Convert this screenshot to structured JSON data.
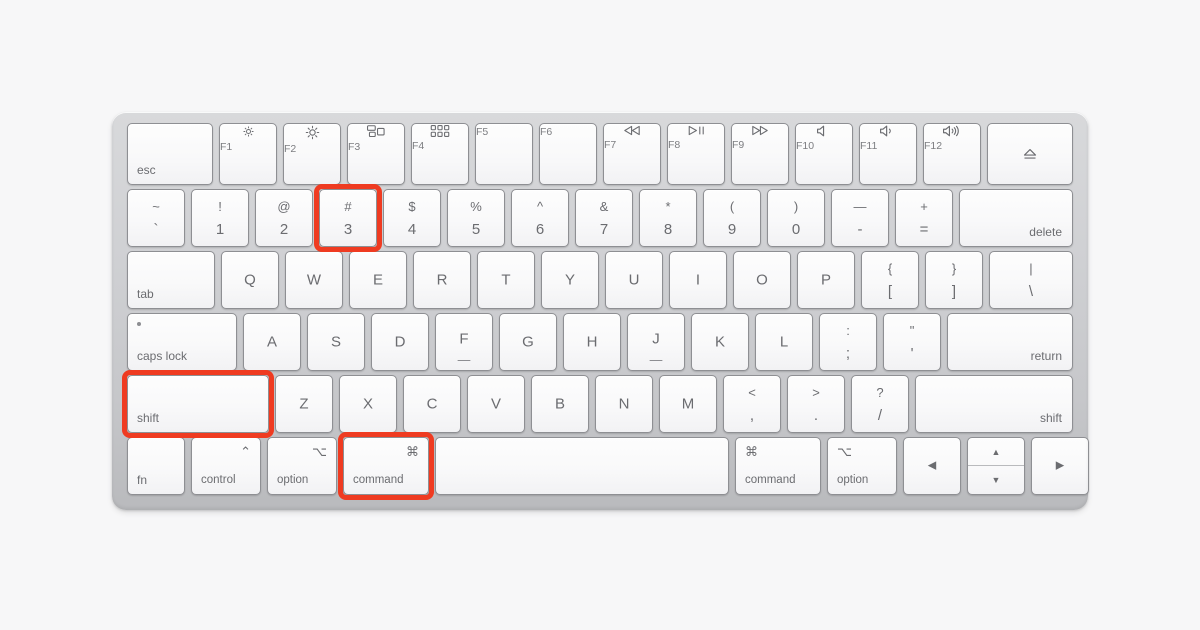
{
  "page": {
    "background_color": "#f7f7f8",
    "subject": "Apple Magic Keyboard",
    "highlight_color": "#ef3b21",
    "highlighted_keys": [
      "shift",
      "command",
      "3"
    ],
    "shortcut": "shift-command-3"
  },
  "keyboard": {
    "body_color": "#cfd0d3",
    "key_color": "#fbfbfc",
    "legend_color": "#6b6c70",
    "rows": [
      {
        "name": "function-row",
        "keys": [
          {
            "id": "esc",
            "label": "esc",
            "style": "bl"
          },
          {
            "id": "f1",
            "label": "F1",
            "icon": "brightness-down-icon",
            "style": "fn"
          },
          {
            "id": "f2",
            "label": "F2",
            "icon": "brightness-up-icon",
            "style": "fn"
          },
          {
            "id": "f3",
            "label": "F3",
            "icon": "mission-control-icon",
            "style": "fn"
          },
          {
            "id": "f4",
            "label": "F4",
            "icon": "launchpad-icon",
            "style": "fn"
          },
          {
            "id": "f5",
            "label": "F5",
            "icon": "none",
            "style": "fn"
          },
          {
            "id": "f6",
            "label": "F6",
            "icon": "none",
            "style": "fn"
          },
          {
            "id": "f7",
            "label": "F7",
            "icon": "rewind-icon",
            "style": "fn"
          },
          {
            "id": "f8",
            "label": "F8",
            "icon": "play-pause-icon",
            "style": "fn"
          },
          {
            "id": "f9",
            "label": "F9",
            "icon": "fast-forward-icon",
            "style": "fn"
          },
          {
            "id": "f10",
            "label": "F10",
            "icon": "mute-icon",
            "style": "fn"
          },
          {
            "id": "f11",
            "label": "F11",
            "icon": "volume-down-icon",
            "style": "fn"
          },
          {
            "id": "f12",
            "label": "F12",
            "icon": "volume-up-icon",
            "style": "fn"
          },
          {
            "id": "eject",
            "label": "",
            "icon": "eject-icon",
            "style": "glyph"
          }
        ]
      },
      {
        "name": "number-row",
        "keys": [
          {
            "id": "backtick",
            "top": "~",
            "bottom": "`"
          },
          {
            "id": "one",
            "top": "!",
            "bottom": "1"
          },
          {
            "id": "two",
            "top": "@",
            "bottom": "2"
          },
          {
            "id": "three",
            "top": "#",
            "bottom": "3",
            "highlighted": true
          },
          {
            "id": "four",
            "top": "$",
            "bottom": "4"
          },
          {
            "id": "five",
            "top": "%",
            "bottom": "5"
          },
          {
            "id": "six",
            "top": "^",
            "bottom": "6"
          },
          {
            "id": "seven",
            "top": "&",
            "bottom": "7"
          },
          {
            "id": "eight",
            "top": "*",
            "bottom": "8"
          },
          {
            "id": "nine",
            "top": "(",
            "bottom": "9"
          },
          {
            "id": "zero",
            "top": ")",
            "bottom": "0"
          },
          {
            "id": "minus",
            "top": "—",
            "bottom": "-"
          },
          {
            "id": "equal",
            "top": "+",
            "bottom": "="
          },
          {
            "id": "delete",
            "label": "delete",
            "style": "br"
          }
        ]
      },
      {
        "name": "qwerty-row",
        "keys": [
          {
            "id": "tab",
            "label": "tab",
            "style": "bl"
          },
          {
            "id": "q",
            "label": "Q"
          },
          {
            "id": "w",
            "label": "W"
          },
          {
            "id": "e",
            "label": "E"
          },
          {
            "id": "r",
            "label": "R"
          },
          {
            "id": "t",
            "label": "T"
          },
          {
            "id": "y",
            "label": "Y"
          },
          {
            "id": "u",
            "label": "U"
          },
          {
            "id": "i",
            "label": "I"
          },
          {
            "id": "o",
            "label": "O"
          },
          {
            "id": "p",
            "label": "P"
          },
          {
            "id": "bracketleft",
            "top": "{",
            "bottom": "["
          },
          {
            "id": "bracketright",
            "top": "}",
            "bottom": "]"
          },
          {
            "id": "backslash",
            "top": "|",
            "bottom": "\\"
          }
        ]
      },
      {
        "name": "home-row",
        "keys": [
          {
            "id": "capslock",
            "label": "caps lock",
            "style": "bl",
            "indicator": "caps-lock-led"
          },
          {
            "id": "a",
            "label": "A"
          },
          {
            "id": "s",
            "label": "S"
          },
          {
            "id": "d",
            "label": "D"
          },
          {
            "id": "f",
            "label": "F",
            "bump": true
          },
          {
            "id": "g",
            "label": "G"
          },
          {
            "id": "h",
            "label": "H"
          },
          {
            "id": "j",
            "label": "J",
            "bump": true
          },
          {
            "id": "k",
            "label": "K"
          },
          {
            "id": "l",
            "label": "L"
          },
          {
            "id": "semicolon",
            "top": ":",
            "bottom": ";"
          },
          {
            "id": "quote",
            "top": "\"",
            "bottom": "'"
          },
          {
            "id": "return",
            "label": "return",
            "style": "br"
          }
        ]
      },
      {
        "name": "shift-row",
        "keys": [
          {
            "id": "shift-left",
            "label": "shift",
            "style": "bl",
            "highlighted": true
          },
          {
            "id": "z",
            "label": "Z"
          },
          {
            "id": "x",
            "label": "X"
          },
          {
            "id": "c",
            "label": "C"
          },
          {
            "id": "v",
            "label": "V"
          },
          {
            "id": "b",
            "label": "B"
          },
          {
            "id": "n",
            "label": "N"
          },
          {
            "id": "m",
            "label": "M"
          },
          {
            "id": "comma",
            "top": "<",
            "bottom": ","
          },
          {
            "id": "period",
            "top": ">",
            "bottom": "."
          },
          {
            "id": "slash",
            "top": "?",
            "bottom": "/"
          },
          {
            "id": "shift-right",
            "label": "shift",
            "style": "br"
          }
        ]
      },
      {
        "name": "modifier-row",
        "keys": [
          {
            "id": "fn",
            "label": "fn",
            "style": "bl"
          },
          {
            "id": "control",
            "label": "control",
            "symbol": "⌃",
            "style": "mod"
          },
          {
            "id": "option-left",
            "label": "option",
            "symbol": "⌥",
            "style": "mod"
          },
          {
            "id": "command-left",
            "label": "command",
            "symbol": "⌘",
            "style": "mod",
            "highlighted": true
          },
          {
            "id": "space",
            "label": "",
            "style": "blank"
          },
          {
            "id": "command-right",
            "label": "command",
            "symbol": "⌘",
            "style": "modl"
          },
          {
            "id": "option-right",
            "label": "option",
            "symbol": "⌥",
            "style": "modl"
          },
          {
            "id": "arrow-left",
            "label": "◀",
            "style": "glyph"
          },
          {
            "id": "arrow-updown",
            "up": "▲",
            "down": "▼",
            "style": "arrowpair"
          },
          {
            "id": "arrow-right",
            "label": "▶",
            "style": "glyph"
          }
        ]
      }
    ]
  }
}
